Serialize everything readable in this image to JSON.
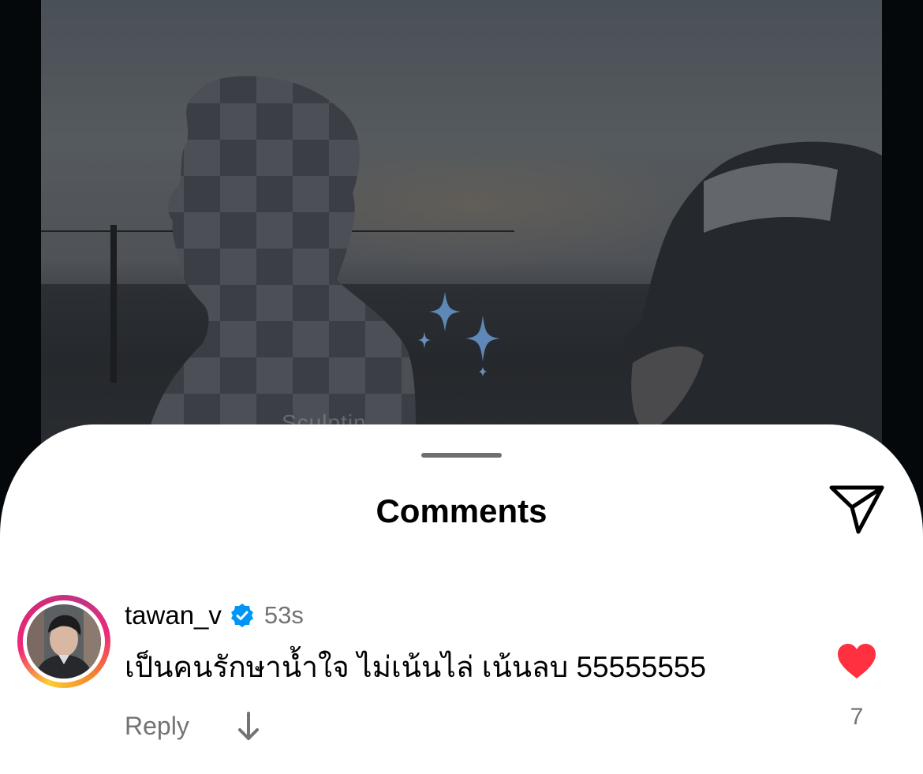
{
  "post": {
    "ghost_caption": "Sculptin..."
  },
  "sheet": {
    "title": "Comments",
    "share_icon": "paper-plane-icon"
  },
  "comment": {
    "username": "tawan_v",
    "verified": true,
    "verified_icon": "verified-badge-icon",
    "timestamp": "53s",
    "text": "เป็นคนรักษาน้ำใจ ไม่เน้นไล่ เน้นลบ 55555555",
    "reply_label": "Reply",
    "translate_icon": "arrow-down-icon",
    "like_icon": "heart-filled-icon",
    "like_count": "7"
  },
  "colors": {
    "heart": "#ff3040",
    "verified": "#0095f6",
    "secondary_text": "#737373",
    "sheet_bg": "#ffffff"
  }
}
